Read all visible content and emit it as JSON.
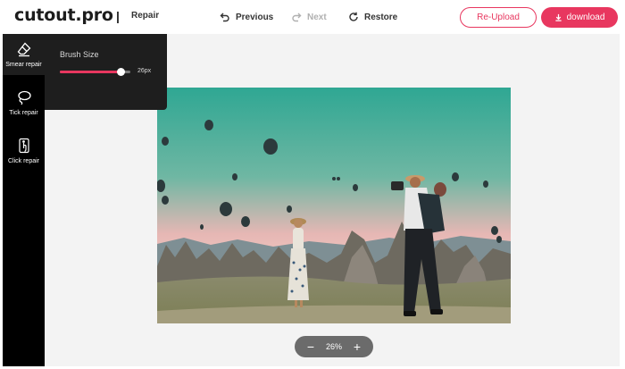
{
  "header": {
    "logo": "cutout.pro",
    "separator": "|",
    "page_label": "Repair",
    "previous_label": "Previous",
    "next_label": "Next",
    "restore_label": "Restore",
    "reupload_label": "Re-Upload",
    "download_label": "download"
  },
  "sidebar": {
    "items": [
      {
        "label": "Smear repair",
        "icon": "eraser-icon",
        "active": true
      },
      {
        "label": "Tick repair",
        "icon": "lasso-icon",
        "active": false
      },
      {
        "label": "Click repair",
        "icon": "tap-icon",
        "active": false
      }
    ]
  },
  "brush": {
    "title": "Brush Size",
    "value_label": "26px",
    "level_fraction": 0.86
  },
  "zoom": {
    "minus": "−",
    "value": "26%",
    "plus": "+"
  },
  "colors": {
    "accent": "#e8375f",
    "sidebar_bg": "#000000",
    "panel_bg": "#1e1e1e",
    "canvas_bg": "#f3f3f3"
  }
}
